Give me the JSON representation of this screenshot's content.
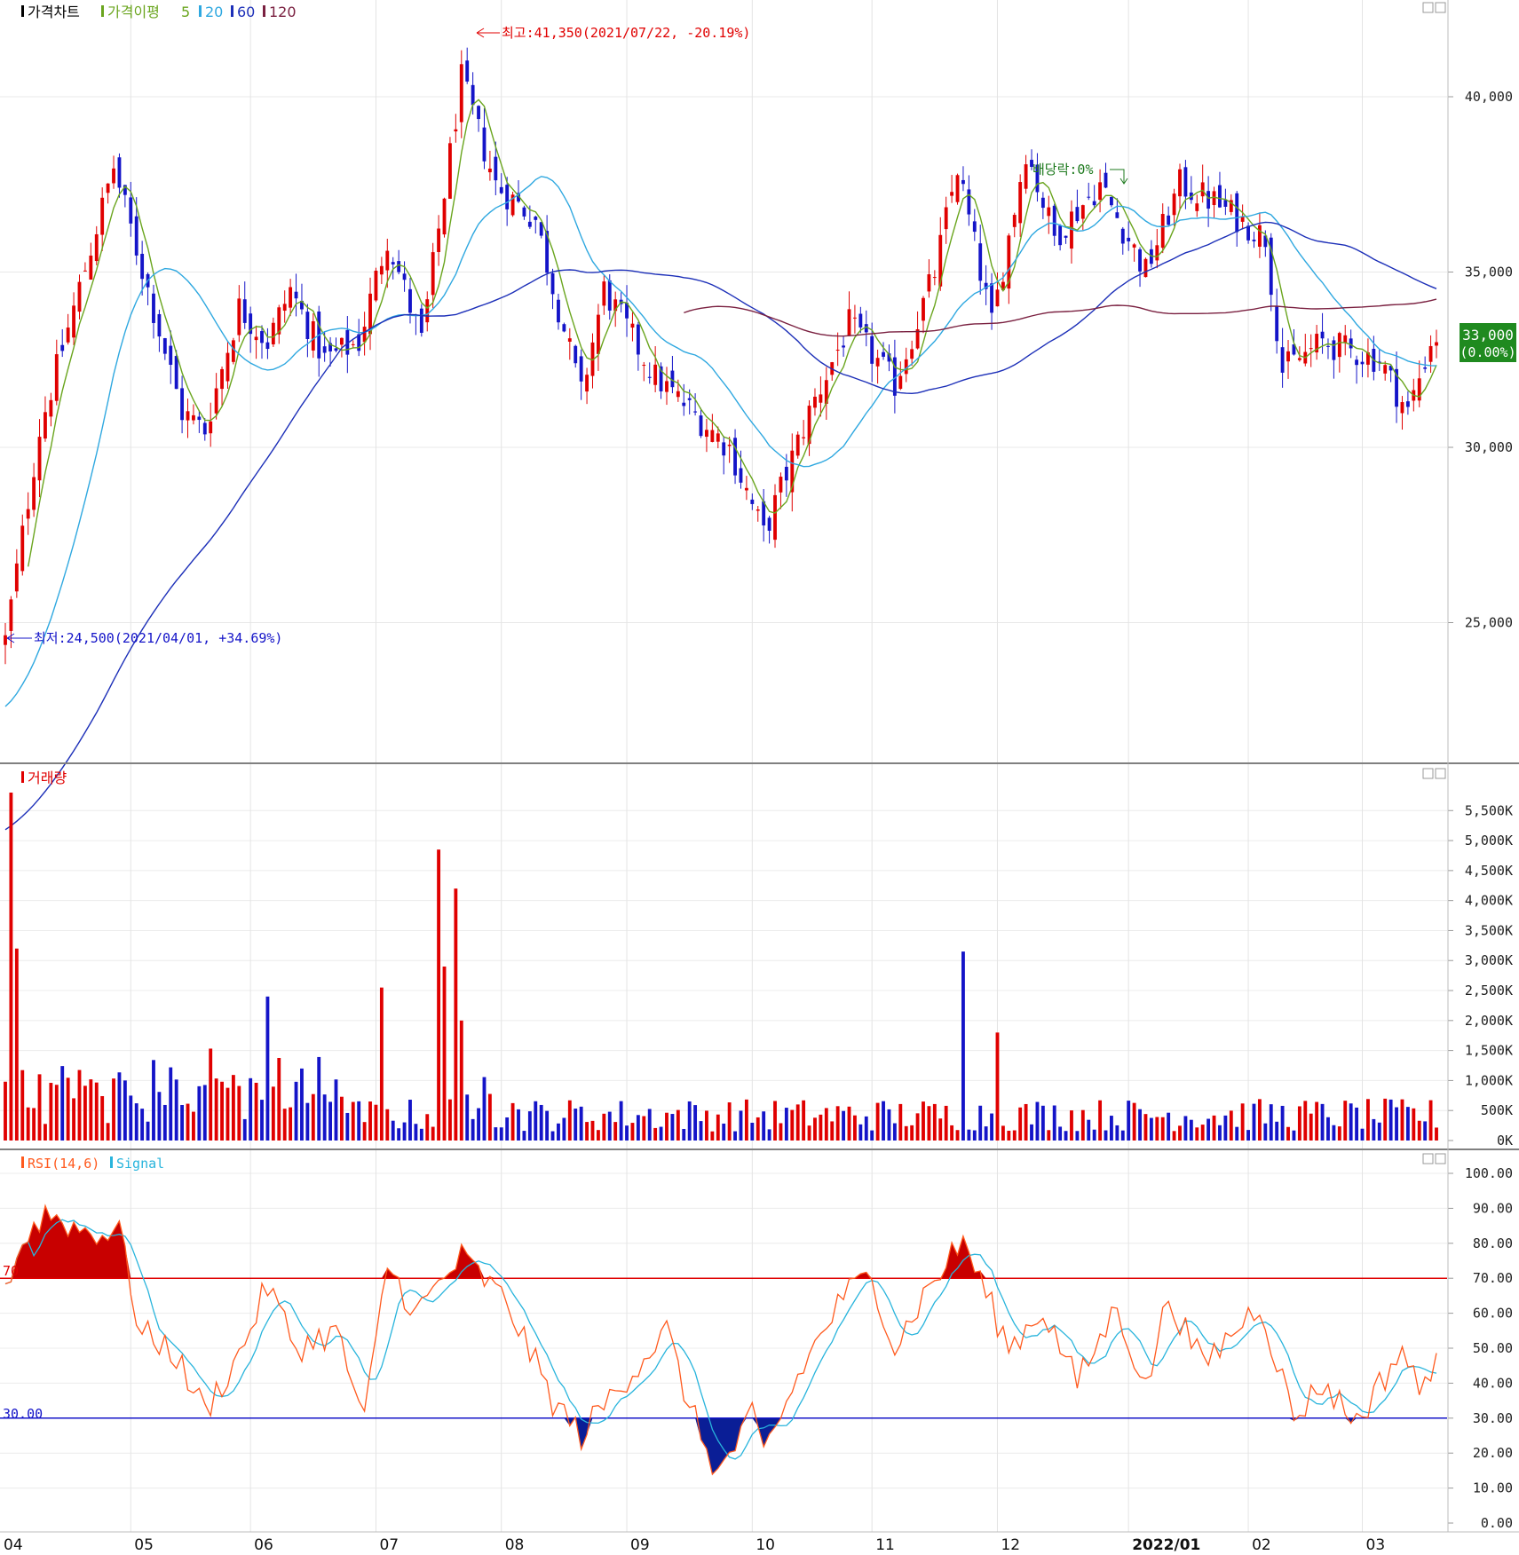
{
  "legend_price": {
    "title": "가격차트",
    "ma_label": "가격이평",
    "ma": [
      {
        "label": "5",
        "color": "#6aa51e"
      },
      {
        "label": "20",
        "color": "#2fa8e0"
      },
      {
        "label": "60",
        "color": "#1c2fb8"
      },
      {
        "label": "120",
        "color": "#7a2040"
      }
    ]
  },
  "legend_volume": {
    "title": "거래량"
  },
  "legend_rsi": {
    "title": "RSI(14,6)",
    "signal": "Signal"
  },
  "annotations": {
    "high": "최고:41,350(2021/07/22, -20.19%)",
    "low": "최저:24,500(2021/04/01, +34.69%)",
    "dividend": "배당락:0%"
  },
  "current": {
    "price": "33,000",
    "change": "(0.00%)"
  },
  "rsi_levels": {
    "upper": "70",
    "lower": "30.00"
  },
  "price_ticks": [
    "40,000",
    "35,000",
    "30,000",
    "25,000"
  ],
  "volume_ticks": [
    "5,500K",
    "5,000K",
    "4,500K",
    "4,000K",
    "3,500K",
    "3,000K",
    "2,500K",
    "2,000K",
    "1,500K",
    "1,000K",
    "500K",
    "0K"
  ],
  "rsi_ticks": [
    "100.00",
    "90.00",
    "80.00",
    "70.00",
    "60.00",
    "50.00",
    "40.00",
    "30.00",
    "20.00",
    "10.00",
    "0.00"
  ],
  "x_labels": [
    "04",
    "05",
    "06",
    "07",
    "08",
    "09",
    "10",
    "11",
    "12",
    "2022/01",
    "02",
    "03"
  ],
  "colors": {
    "up": "#e00000",
    "down": "#1414c8",
    "rsi_line": "#ff5a1e",
    "signal_line": "#28b4dc",
    "level70": "#e00000",
    "level30": "#1414c8"
  },
  "chart_data": [
    {
      "type": "candlestick",
      "title": "가격차트",
      "ylim": [
        22000,
        42500
      ],
      "ohlc_keyframes": [
        {
          "date": "2021-04-01",
          "close": 24500
        },
        {
          "date": "2021-04-09",
          "close": 30500
        },
        {
          "date": "2021-04-28",
          "close": 38000
        },
        {
          "date": "2021-05-14",
          "close": 31000
        },
        {
          "date": "2021-05-20",
          "close": 30500
        },
        {
          "date": "2021-05-28",
          "close": 34000
        },
        {
          "date": "2021-06-04",
          "close": 33000
        },
        {
          "date": "2021-06-10",
          "close": 34500
        },
        {
          "date": "2021-06-18",
          "close": 32500
        },
        {
          "date": "2021-06-28",
          "close": 33000
        },
        {
          "date": "2021-07-05",
          "close": 36000
        },
        {
          "date": "2021-07-13",
          "close": 33000
        },
        {
          "date": "2021-07-22",
          "close": 40500
        },
        {
          "date": "2021-07-30",
          "close": 37500
        },
        {
          "date": "2021-08-10",
          "close": 36500
        },
        {
          "date": "2021-08-20",
          "close": 31500
        },
        {
          "date": "2021-08-26",
          "close": 34500
        },
        {
          "date": "2021-09-08",
          "close": 32000
        },
        {
          "date": "2021-09-27",
          "close": 30000
        },
        {
          "date": "2021-10-05",
          "close": 27500
        },
        {
          "date": "2021-10-15",
          "close": 31000
        },
        {
          "date": "2021-10-26",
          "close": 33500
        },
        {
          "date": "2021-11-05",
          "close": 31800
        },
        {
          "date": "2021-11-16",
          "close": 35000
        },
        {
          "date": "2021-11-22",
          "close": 38000
        },
        {
          "date": "2021-11-30",
          "close": 33500
        },
        {
          "date": "2021-12-08",
          "close": 38500
        },
        {
          "date": "2021-12-15",
          "close": 36000
        },
        {
          "date": "2021-12-27",
          "close": 37500
        },
        {
          "date": "2022-01-06",
          "close": 35000
        },
        {
          "date": "2022-01-14",
          "close": 37500
        },
        {
          "date": "2022-01-24",
          "close": 37000
        },
        {
          "date": "2022-02-04",
          "close": 36000
        },
        {
          "date": "2022-02-09",
          "close": 32200
        },
        {
          "date": "2022-02-18",
          "close": 33000
        },
        {
          "date": "2022-03-04",
          "close": 32500
        },
        {
          "date": "2022-03-11",
          "close": 31000
        },
        {
          "date": "2022-03-17",
          "close": 33000
        }
      ],
      "moving_averages": [
        "5",
        "20",
        "60",
        "120"
      ]
    },
    {
      "type": "bar",
      "title": "거래량",
      "unit": "K",
      "ylim": [
        0,
        5800
      ],
      "spikes": [
        {
          "date": "2021-04-02",
          "value": 5800
        },
        {
          "date": "2021-04-05",
          "value": 3200
        },
        {
          "date": "2021-07-02",
          "value": 2550
        },
        {
          "date": "2021-07-16",
          "value": 4850
        },
        {
          "date": "2021-07-19",
          "value": 2900
        },
        {
          "date": "2021-07-21",
          "value": 4200
        },
        {
          "date": "2021-07-22",
          "value": 2000
        },
        {
          "date": "2021-11-23",
          "value": 3150
        },
        {
          "date": "2021-12-01",
          "value": 1800
        },
        {
          "date": "2021-06-04",
          "value": 2400
        }
      ]
    },
    {
      "type": "line",
      "title": "RSI(14,6)",
      "ylim": [
        0,
        100
      ],
      "levels": [
        70,
        30
      ],
      "rsi_keyframes": [
        {
          "date": "2021-04-01",
          "value": 68
        },
        {
          "date": "2021-04-06",
          "value": 80
        },
        {
          "date": "2021-04-12",
          "value": 89
        },
        {
          "date": "2021-04-20",
          "value": 84
        },
        {
          "date": "2021-04-30",
          "value": 82
        },
        {
          "date": "2021-05-04",
          "value": 55
        },
        {
          "date": "2021-05-12",
          "value": 50
        },
        {
          "date": "2021-05-20",
          "value": 32
        },
        {
          "date": "2021-05-28",
          "value": 48
        },
        {
          "date": "2021-06-04",
          "value": 68
        },
        {
          "date": "2021-06-11",
          "value": 50
        },
        {
          "date": "2021-06-22",
          "value": 55
        },
        {
          "date": "2021-06-29",
          "value": 29
        },
        {
          "date": "2021-07-05",
          "value": 74
        },
        {
          "date": "2021-07-12",
          "value": 60
        },
        {
          "date": "2021-07-22",
          "value": 76
        },
        {
          "date": "2021-08-03",
          "value": 63
        },
        {
          "date": "2021-08-13",
          "value": 35
        },
        {
          "date": "2021-08-20",
          "value": 25
        },
        {
          "date": "2021-08-30",
          "value": 38
        },
        {
          "date": "2021-09-10",
          "value": 55
        },
        {
          "date": "2021-09-16",
          "value": 33
        },
        {
          "date": "2021-09-23",
          "value": 14
        },
        {
          "date": "2021-10-01",
          "value": 30
        },
        {
          "date": "2021-10-05",
          "value": 20
        },
        {
          "date": "2021-10-14",
          "value": 45
        },
        {
          "date": "2021-10-25",
          "value": 65
        },
        {
          "date": "2021-11-01",
          "value": 71
        },
        {
          "date": "2021-11-05",
          "value": 50
        },
        {
          "date": "2021-11-12",
          "value": 65
        },
        {
          "date": "2021-11-23",
          "value": 81
        },
        {
          "date": "2021-12-03",
          "value": 50
        },
        {
          "date": "2021-12-13",
          "value": 61
        },
        {
          "date": "2021-12-21",
          "value": 40
        },
        {
          "date": "2021-12-30",
          "value": 62
        },
        {
          "date": "2022-01-06",
          "value": 38
        },
        {
          "date": "2022-01-12",
          "value": 65
        },
        {
          "date": "2022-01-20",
          "value": 45
        },
        {
          "date": "2022-02-03",
          "value": 63
        },
        {
          "date": "2022-02-11",
          "value": 30
        },
        {
          "date": "2022-02-18",
          "value": 40
        },
        {
          "date": "2022-02-28",
          "value": 29
        },
        {
          "date": "2022-03-10",
          "value": 50
        },
        {
          "date": "2022-03-15",
          "value": 37
        },
        {
          "date": "2022-03-18",
          "value": 49
        }
      ],
      "series": [
        {
          "name": "RSI(14,6)"
        },
        {
          "name": "Signal"
        }
      ]
    }
  ]
}
